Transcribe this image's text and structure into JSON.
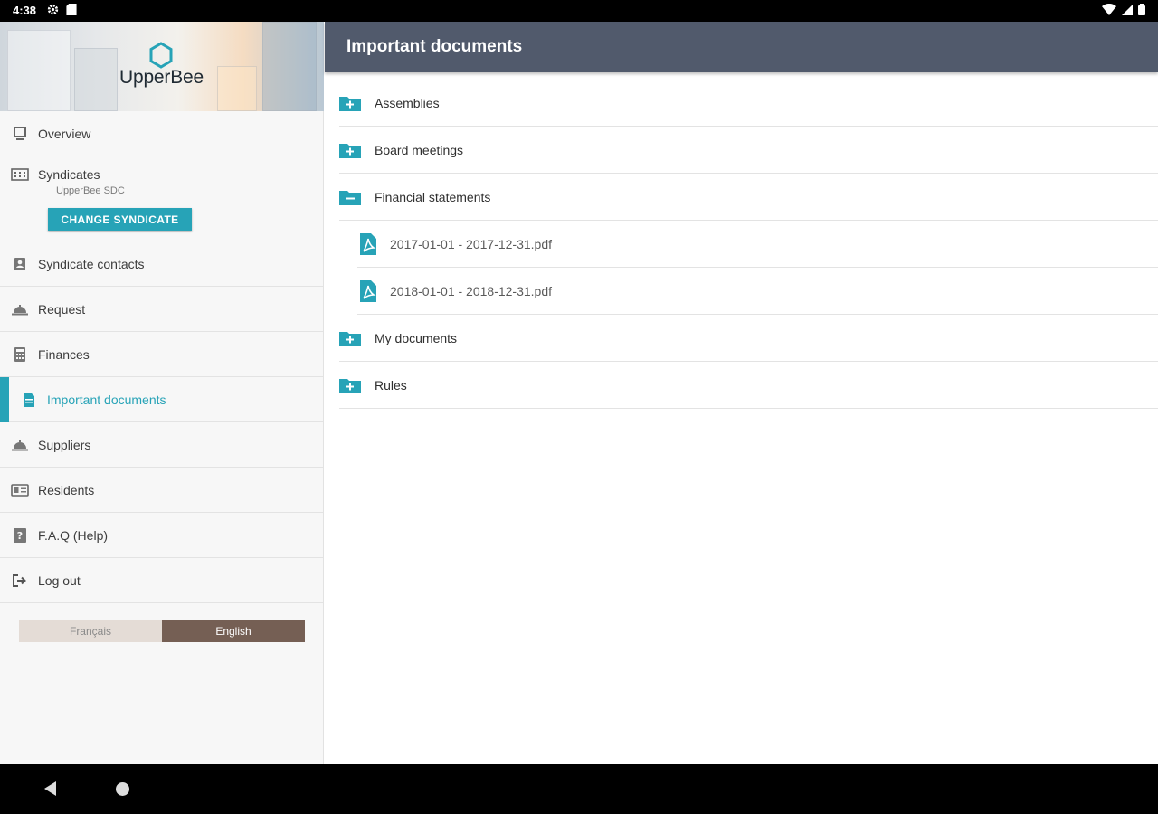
{
  "status_bar": {
    "time": "4:38",
    "icons": [
      "settings-icon",
      "sd-card-icon",
      "wifi-icon",
      "signal-icon",
      "battery-icon"
    ]
  },
  "sidebar": {
    "logo_text": "UpperBee",
    "items": [
      {
        "label": "Overview",
        "icon": "monitor-icon"
      },
      {
        "label": "Syndicates",
        "icon": "building-icon",
        "subtitle": "UpperBee SDC",
        "button": "CHANGE SYNDICATE"
      },
      {
        "label": "Syndicate contacts",
        "icon": "contact-book-icon"
      },
      {
        "label": "Request",
        "icon": "service-bell-icon"
      },
      {
        "label": "Finances",
        "icon": "calculator-icon"
      },
      {
        "label": "Important documents",
        "icon": "document-icon",
        "active": true
      },
      {
        "label": "Suppliers",
        "icon": "service-bell-icon"
      },
      {
        "label": "Residents",
        "icon": "id-card-icon"
      },
      {
        "label": "F.A.Q (Help)",
        "icon": "help-icon"
      },
      {
        "label": "Log out",
        "icon": "logout-icon"
      }
    ],
    "languages": {
      "fr": "Français",
      "en": "English",
      "selected": "English"
    }
  },
  "main": {
    "title": "Important documents",
    "rows": [
      {
        "label": "Assemblies",
        "type": "folder",
        "expanded": false
      },
      {
        "label": "Board meetings",
        "type": "folder",
        "expanded": false
      },
      {
        "label": "Financial statements",
        "type": "folder",
        "expanded": true
      },
      {
        "label": "2017-01-01 - 2017-12-31.pdf",
        "type": "pdf"
      },
      {
        "label": "2018-01-01 - 2018-12-31.pdf",
        "type": "pdf"
      },
      {
        "label": "My documents",
        "type": "folder",
        "expanded": false
      },
      {
        "label": "Rules",
        "type": "folder",
        "expanded": false
      }
    ]
  },
  "colors": {
    "accent": "#27a3b7",
    "topbar": "#515a6c",
    "lang_selected": "#755f54"
  }
}
